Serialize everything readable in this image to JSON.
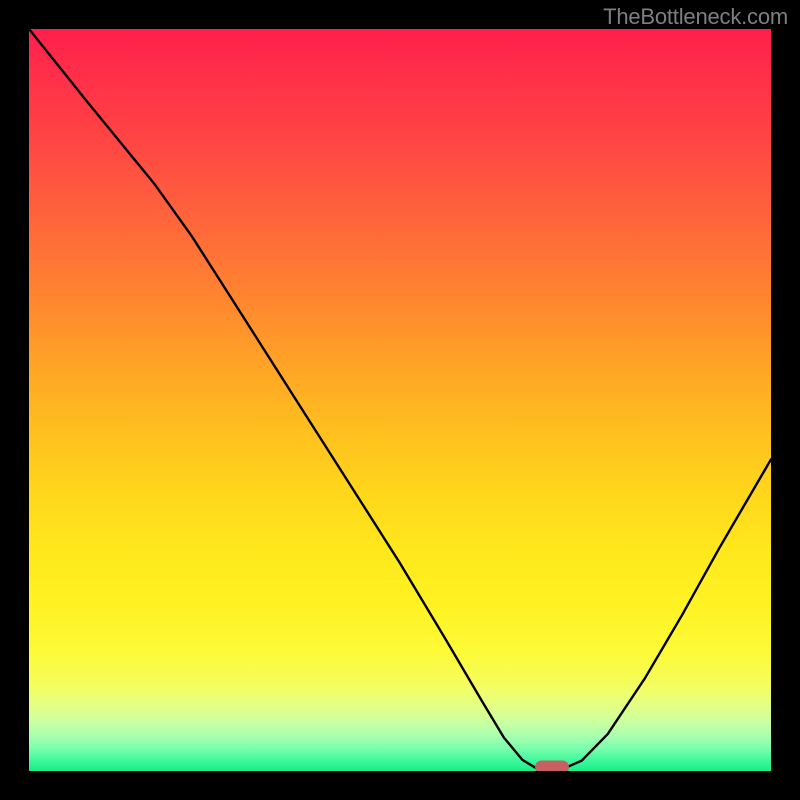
{
  "watermark": "TheBottleneck.com",
  "chart_data": {
    "type": "line",
    "title": "",
    "xlabel": "",
    "ylabel": "",
    "x_range": [
      0,
      1
    ],
    "y_range": [
      0,
      1
    ],
    "gradient_stops": [
      {
        "pos": 0.0,
        "color": "#ff1f4a"
      },
      {
        "pos": 0.3,
        "color": "#ff8b2e"
      },
      {
        "pos": 0.62,
        "color": "#ffd51b"
      },
      {
        "pos": 0.84,
        "color": "#fdfa38"
      },
      {
        "pos": 1.0,
        "color": "#17ee8a"
      }
    ],
    "curve": [
      {
        "x": 0.0,
        "y": 1.0
      },
      {
        "x": 0.08,
        "y": 0.9
      },
      {
        "x": 0.17,
        "y": 0.79
      },
      {
        "x": 0.22,
        "y": 0.72
      },
      {
        "x": 0.29,
        "y": 0.61
      },
      {
        "x": 0.36,
        "y": 0.5
      },
      {
        "x": 0.43,
        "y": 0.39
      },
      {
        "x": 0.5,
        "y": 0.28
      },
      {
        "x": 0.56,
        "y": 0.18
      },
      {
        "x": 0.61,
        "y": 0.095
      },
      {
        "x": 0.64,
        "y": 0.045
      },
      {
        "x": 0.665,
        "y": 0.015
      },
      {
        "x": 0.685,
        "y": 0.003
      },
      {
        "x": 0.72,
        "y": 0.003
      },
      {
        "x": 0.745,
        "y": 0.014
      },
      {
        "x": 0.78,
        "y": 0.05
      },
      {
        "x": 0.83,
        "y": 0.125
      },
      {
        "x": 0.88,
        "y": 0.21
      },
      {
        "x": 0.93,
        "y": 0.3
      },
      {
        "x": 1.0,
        "y": 0.42
      }
    ],
    "marker": {
      "x": 0.705,
      "y": 0.005,
      "color": "#c66062"
    }
  }
}
